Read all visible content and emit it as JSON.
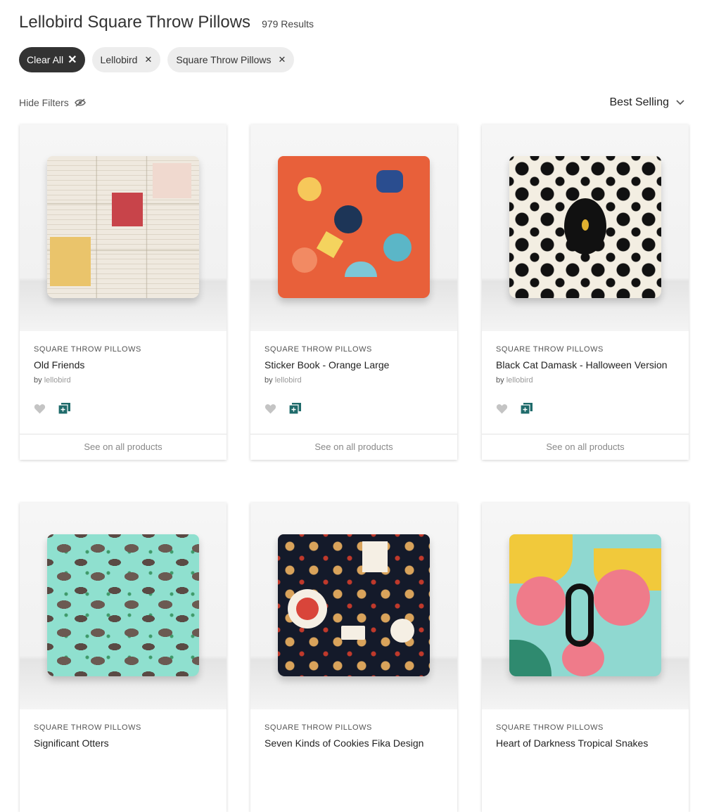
{
  "header": {
    "title": "Lellobird Square Throw Pillows",
    "results": "979 Results"
  },
  "chips": {
    "clear_all": "Clear All",
    "designer": "Lellobird",
    "category": "Square Throw Pillows"
  },
  "filterbar": {
    "hide_filters": "Hide Filters",
    "sort": "Best Selling"
  },
  "products": [
    {
      "category": "SQUARE THROW PILLOWS",
      "title": "Old Friends",
      "by": "by",
      "author": "lellobird",
      "see_all": "See on all products"
    },
    {
      "category": "SQUARE THROW PILLOWS",
      "title": "Sticker Book - Orange Large",
      "by": "by",
      "author": "lellobird",
      "see_all": "See on all products"
    },
    {
      "category": "SQUARE THROW PILLOWS",
      "title": "Black Cat Damask - Halloween Version",
      "by": "by",
      "author": "lellobird",
      "see_all": "See on all products"
    },
    {
      "category": "SQUARE THROW PILLOWS",
      "title": "Significant Otters"
    },
    {
      "category": "SQUARE THROW PILLOWS",
      "title": "Seven Kinds of Cookies Fika Design"
    },
    {
      "category": "SQUARE THROW PILLOWS",
      "title": "Heart of Darkness Tropical Snakes"
    }
  ],
  "icons": {
    "favorite": "heart-icon",
    "collection": "add-to-collection-icon",
    "visibility": "eye-off-icon",
    "sort": "chevron-down-icon",
    "remove": "close-icon"
  },
  "colors": {
    "chip_dark": "#333333",
    "chip_light": "#ededed",
    "accent_teal": "#1f6b6b"
  }
}
